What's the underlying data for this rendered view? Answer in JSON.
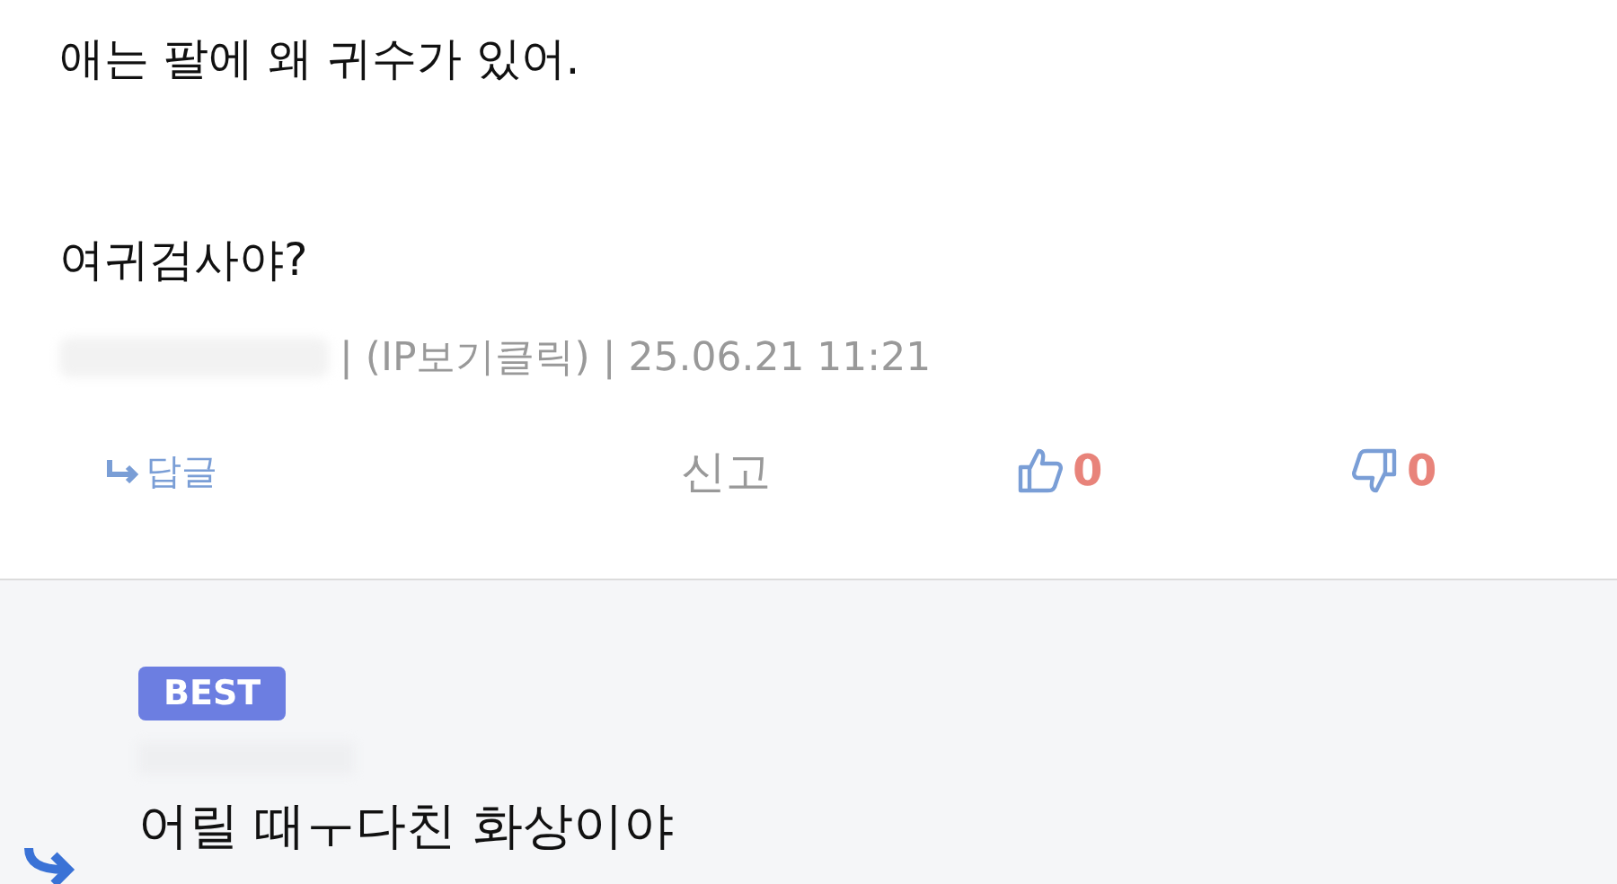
{
  "comment": {
    "lines": [
      "애는 팔에 왜 귀수가 있어.",
      "여귀검사야?"
    ],
    "meta": [
      "| (IP보기클릭) | 25.06.21 11:21"
    ],
    "reply_button": "답글",
    "report_button": "신고",
    "likes": "0",
    "dislikes": "0"
  },
  "reply": {
    "badge": "BEST",
    "text": "어릴 때ㅜ다친 화상이야"
  }
}
